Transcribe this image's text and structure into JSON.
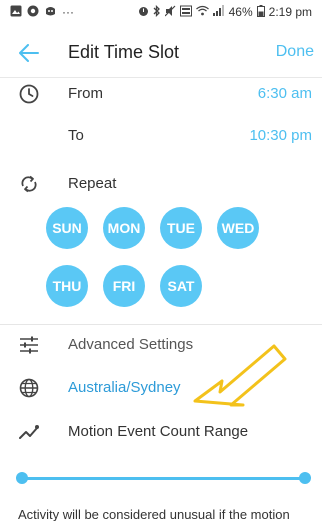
{
  "status_bar": {
    "dots": "···",
    "battery": "46%",
    "time": "2:19 pm"
  },
  "header": {
    "title": "Edit Time Slot",
    "done_label": "Done"
  },
  "time_slot": {
    "from_label": "From",
    "from_value": "6:30 am",
    "to_label": "To",
    "to_value": "10:30 pm"
  },
  "repeat": {
    "label": "Repeat",
    "days": [
      "SUN",
      "MON",
      "TUE",
      "WED",
      "THU",
      "FRI",
      "SAT"
    ]
  },
  "settings": {
    "advanced_label": "Advanced Settings",
    "timezone_label": "Australia/Sydney",
    "motion_label": "Motion Event Count Range"
  },
  "slider": {
    "min_fraction": 0.0,
    "max_fraction": 1.0
  },
  "footer": {
    "text": "Activity will be considered unusual if the motion"
  },
  "colors": {
    "accent": "#4dbff0",
    "day_bubble": "#5ac8f5",
    "annotation_arrow": "#f3c21b"
  }
}
